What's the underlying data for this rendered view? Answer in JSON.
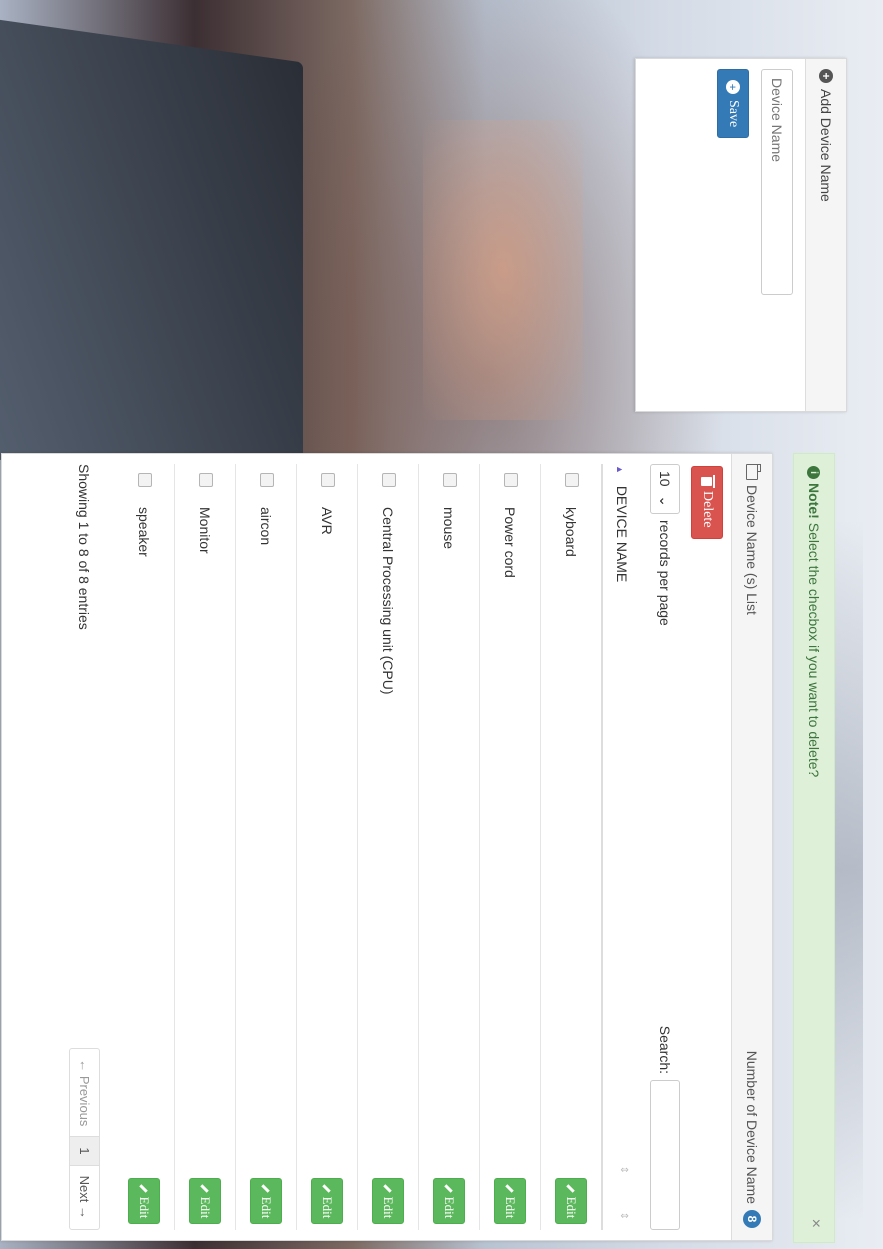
{
  "add_panel": {
    "title": "Add Device Name",
    "input_placeholder": "Device Name",
    "save_label": "Save"
  },
  "note": {
    "lead": "Note!",
    "text": "Select the checbox if you want to delete?",
    "close": "×"
  },
  "list_panel": {
    "title": "Device Name (s) List",
    "count_label": "Number of Device Name",
    "count": "8",
    "delete_label": "Delete",
    "records_value": "10",
    "records_label": "records per page",
    "search_label": "Search:",
    "column_header": "DEVICE NAME",
    "rows": [
      "kyboard",
      "Power cord",
      "mouse",
      "Central Processing unit (CPU)",
      "AVR",
      "aircon",
      "Monitor",
      "speaker"
    ],
    "edit_label": "Edit",
    "info": "Showing 1 to 8 of 8 entries",
    "prev_label": "← Previous",
    "page": "1",
    "next_label": "Next →"
  },
  "colors": {
    "primary": "#337ab7",
    "danger": "#d9534f",
    "success": "#5cb85c",
    "alert_bg": "#dff0d8"
  }
}
